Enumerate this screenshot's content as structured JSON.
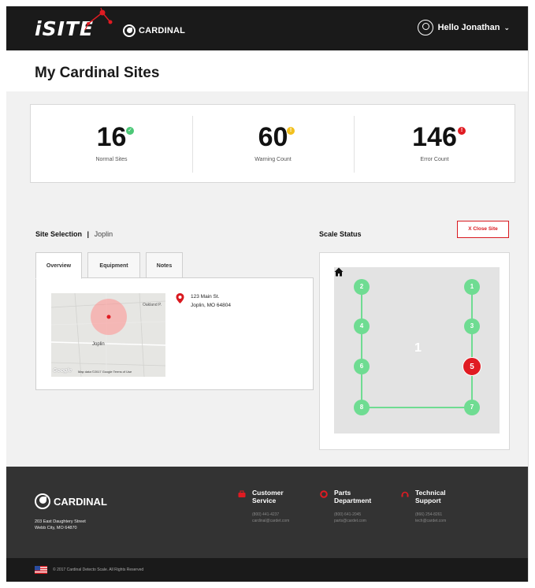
{
  "header": {
    "app_logo_text": "iSITE",
    "brand_text": "CARDINAL",
    "greeting": "Hello Jonathan",
    "menu_chevron": "⌄"
  },
  "page": {
    "title": "My Cardinal Sites"
  },
  "stats": [
    {
      "value": "16",
      "label": "Normal Sites",
      "badge": "✓",
      "color": "#4cc877"
    },
    {
      "value": "60",
      "label": "Warning Count",
      "badge": "!",
      "color": "#f2c01e"
    },
    {
      "value": "146",
      "label": "Error Count",
      "badge": "!",
      "color": "#e01b22"
    }
  ],
  "site_selection": {
    "label": "Site Selection",
    "divider": "|",
    "value": "Joplin",
    "tabs": [
      {
        "label": "Overview",
        "active": true
      },
      {
        "label": "Equipment",
        "active": false
      },
      {
        "label": "Notes",
        "active": false
      }
    ],
    "map": {
      "place_label": "Joplin",
      "nearby_label": "Oakland P.",
      "google_label": "Google",
      "footer_text": "Map data ©2017 Google   Terms of Use"
    },
    "address": {
      "line1": "123 Main St.",
      "line2": "Joplin, MO 64804"
    }
  },
  "scale_status": {
    "label": "Scale Status",
    "close_button": "X Close Site",
    "center_label": "1",
    "nodes": [
      {
        "id": "2",
        "status": "normal"
      },
      {
        "id": "4",
        "status": "normal"
      },
      {
        "id": "6",
        "status": "normal"
      },
      {
        "id": "8",
        "status": "normal"
      },
      {
        "id": "1",
        "status": "normal"
      },
      {
        "id": "3",
        "status": "normal"
      },
      {
        "id": "5",
        "status": "error"
      },
      {
        "id": "7",
        "status": "normal"
      }
    ]
  },
  "footer": {
    "brand_text": "CARDINAL",
    "address_line1": "203 East Daughtery Street",
    "address_line2": "Webb City, MO 64870",
    "contacts": [
      {
        "title_line1": "Customer",
        "title_line2": "Service",
        "phone": "(800) 441-4237",
        "email": "cardinal@cardet.com",
        "icon": "briefcase-icon"
      },
      {
        "title_line1": "Parts",
        "title_line2": "Department",
        "phone": "(800) 641-2045",
        "email": "parts@cardet.com",
        "icon": "gear-icon"
      },
      {
        "title_line1": "Technical",
        "title_line2": "Support",
        "phone": "(866) 254-8261",
        "email": "tech@cardet.com",
        "icon": "headset-icon"
      }
    ],
    "copyright": "© 2017 Cardinal Detecto Scale. All Rights Reserved"
  },
  "colors": {
    "accent_red": "#d9191f",
    "node_green": "#6fdc92",
    "node_error": "#e01b22"
  }
}
